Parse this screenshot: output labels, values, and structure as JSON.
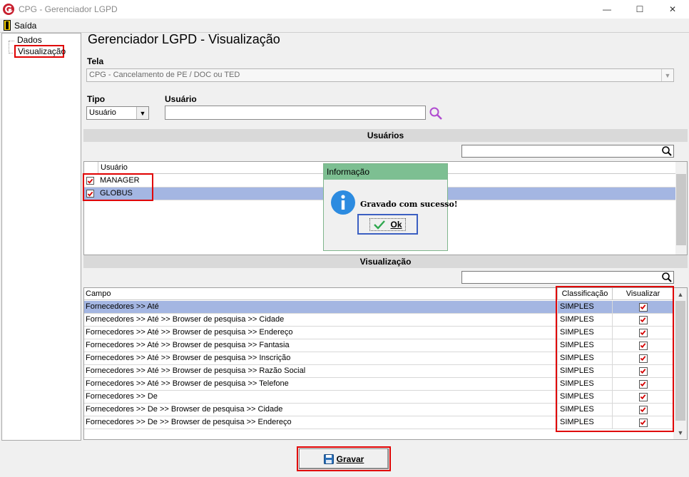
{
  "window": {
    "title": "CPG - Gerenciador LGPD",
    "min_glyph": "—",
    "max_glyph": "☐",
    "close_glyph": "✕"
  },
  "menu": {
    "saida": "Saída"
  },
  "tree": {
    "items": [
      "Dados",
      "Visualização"
    ]
  },
  "page": {
    "title": "Gerenciador LGPD - Visualização"
  },
  "tela": {
    "label": "Tela",
    "value": "CPG - Cancelamento de PE / DOC ou TED",
    "arrow": "▼"
  },
  "tipo": {
    "label": "Tipo",
    "value": "Usuário",
    "arrow": "▼"
  },
  "usuario": {
    "label": "Usuário",
    "value": ""
  },
  "usuarios_section": {
    "title": "Usuários",
    "column": "Usuário",
    "rows": [
      {
        "name": "MANAGER",
        "checked": true
      },
      {
        "name": "GLOBUS",
        "checked": true
      }
    ]
  },
  "vis_section": {
    "title": "Visualização",
    "columns": {
      "campo": "Campo",
      "classificacao": "Classificação",
      "visualizar": "Visualizar"
    },
    "rows": [
      {
        "campo": "Fornecedores >> Até",
        "classificacao": "SIMPLES",
        "visualizar": true
      },
      {
        "campo": "Fornecedores >> Até >> Browser de pesquisa >> Cidade",
        "classificacao": "SIMPLES",
        "visualizar": true
      },
      {
        "campo": "Fornecedores >> Até >> Browser de pesquisa >> Endereço",
        "classificacao": "SIMPLES",
        "visualizar": true
      },
      {
        "campo": "Fornecedores >> Até >> Browser de pesquisa >> Fantasia",
        "classificacao": "SIMPLES",
        "visualizar": true
      },
      {
        "campo": "Fornecedores >> Até >> Browser de pesquisa >> Inscrição",
        "classificacao": "SIMPLES",
        "visualizar": true
      },
      {
        "campo": "Fornecedores >> Até >> Browser de pesquisa >> Razão Social",
        "classificacao": "SIMPLES",
        "visualizar": true
      },
      {
        "campo": "Fornecedores >> Até >> Browser de pesquisa >> Telefone",
        "classificacao": "SIMPLES",
        "visualizar": true
      },
      {
        "campo": "Fornecedores >> De",
        "classificacao": "SIMPLES",
        "visualizar": true
      },
      {
        "campo": "Fornecedores >> De >> Browser de pesquisa >> Cidade",
        "classificacao": "SIMPLES",
        "visualizar": true
      },
      {
        "campo": "Fornecedores >> De >> Browser de pesquisa >> Endereço",
        "classificacao": "SIMPLES",
        "visualizar": true
      }
    ],
    "scroll_up": "▲",
    "scroll_down": "▼"
  },
  "gravar": {
    "label": "Gravar"
  },
  "dialog": {
    "title": "Informação",
    "message": "Gravado com sucesso!",
    "ok": "Ok"
  },
  "colors": {
    "selected_row": "#a4b6e2",
    "highlight": "#e00000",
    "dialog_title": "#7dbf92",
    "check": "#d40000"
  },
  "icons": {
    "app": "cpg-logo-icon",
    "exit": "exit-door-icon",
    "search": "magnifier-icon",
    "save": "floppy-disk-icon",
    "info": "info-icon",
    "ok": "checkmark-icon"
  }
}
